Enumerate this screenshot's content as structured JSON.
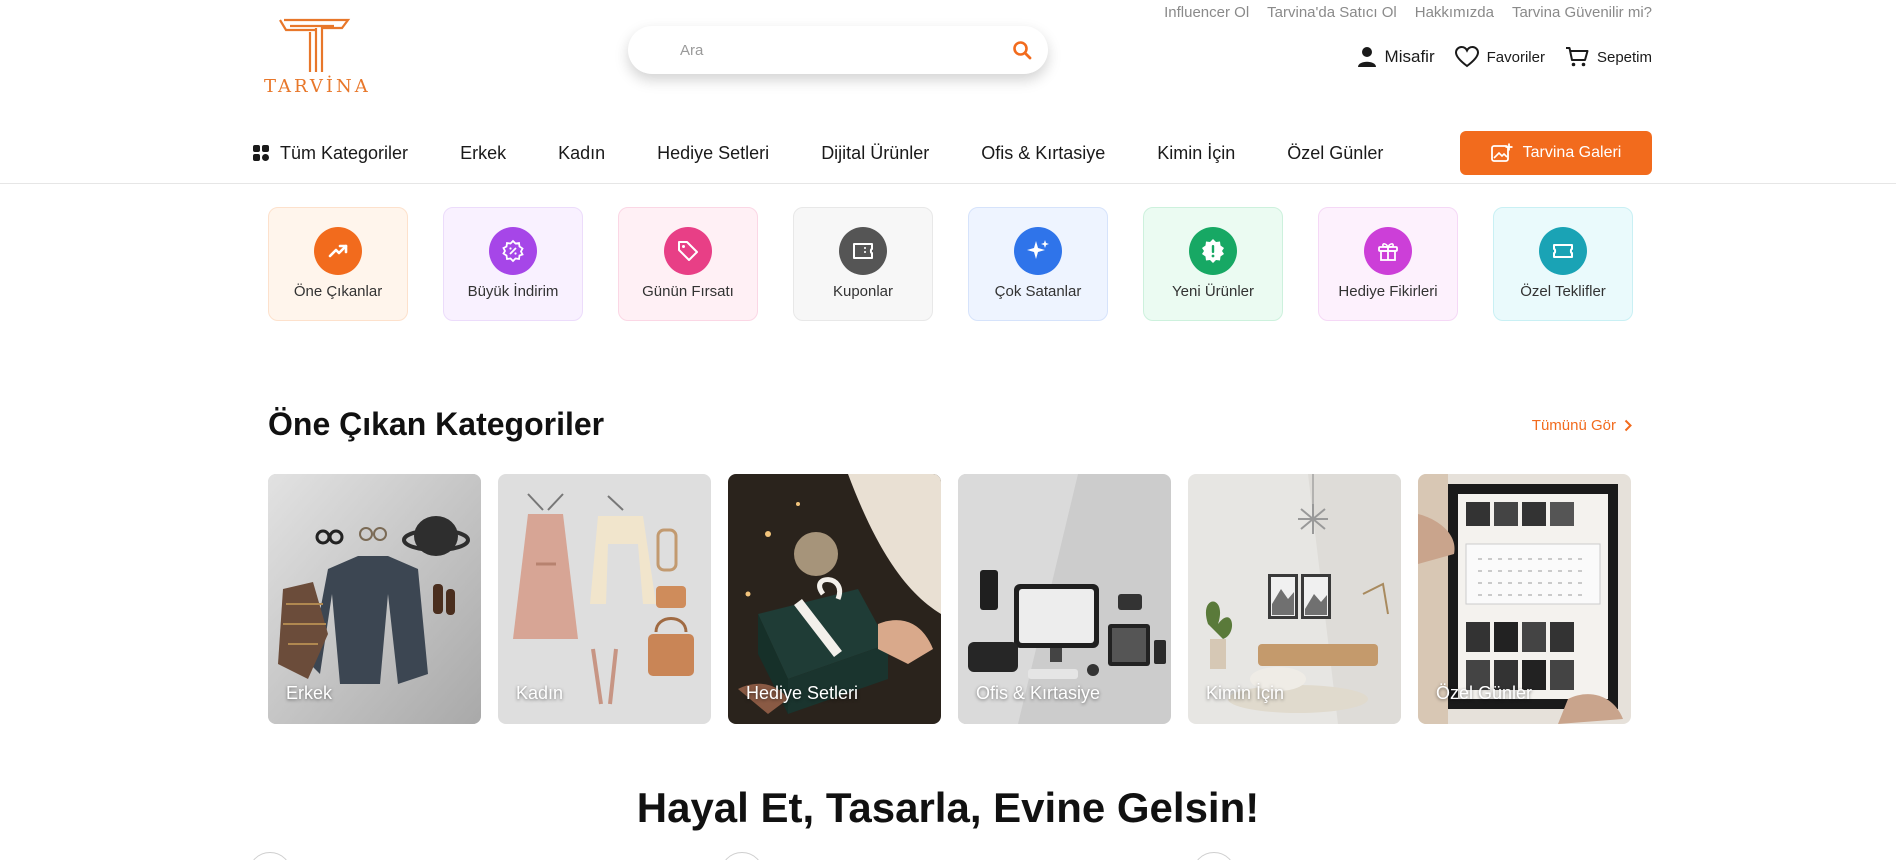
{
  "brand": {
    "name": "TARVİNA",
    "color": "#e8772a"
  },
  "top_links": [
    "Influencer Ol",
    "Tarvina'da Satıcı Ol",
    "Hakkımızda",
    "Tarvina Güvenilir mi?"
  ],
  "search": {
    "placeholder": "Ara",
    "value": ""
  },
  "user_actions": {
    "guest": "Misafir",
    "favorites": "Favoriler",
    "cart": "Sepetim"
  },
  "nav": {
    "all_categories": "Tüm Kategoriler",
    "items": [
      "Erkek",
      "Kadın",
      "Hediye Setleri",
      "Dijital Ürünler",
      "Ofis & Kırtasiye",
      "Kimin İçin",
      "Özel Günler"
    ],
    "gallery_button": "Tarvina Galeri"
  },
  "quick_tiles": [
    {
      "label": "Öne Çıkanlar",
      "icon": "trending-up-icon",
      "color": "#f26b1d",
      "bg": "#fff5ec",
      "border": "#fde1cc"
    },
    {
      "label": "Büyük İndirim",
      "icon": "discount-badge-icon",
      "color": "#a646e8",
      "bg": "#f9f1ff",
      "border": "#ecdcfb"
    },
    {
      "label": "Günün Fırsatı",
      "icon": "tag-icon",
      "color": "#e83f86",
      "bg": "#fff0f5",
      "border": "#fbd7e5"
    },
    {
      "label": "Kuponlar",
      "icon": "coupon-icon",
      "color": "#555555",
      "bg": "#f7f7f7",
      "border": "#e8e8e8"
    },
    {
      "label": "Çok Satanlar",
      "icon": "sparkles-icon",
      "color": "#2f74ea",
      "bg": "#eef4ff",
      "border": "#d6e3fb"
    },
    {
      "label": "Yeni Ürünler",
      "icon": "new-badge-icon",
      "color": "#17a864",
      "bg": "#ebfbf2",
      "border": "#cdf1dd"
    },
    {
      "label": "Hediye Fikirleri",
      "icon": "gift-icon",
      "color": "#cc3fd8",
      "bg": "#fdf1fd",
      "border": "#f5d8f6"
    },
    {
      "label": "Özel Teklifler",
      "icon": "ticket-icon",
      "color": "#1aa3b5",
      "bg": "#eafafc",
      "border": "#c9f0f4"
    }
  ],
  "featured": {
    "title": "Öne Çıkan Kategoriler",
    "see_all": "Tümünü Gör",
    "categories": [
      "Erkek",
      "Kadın",
      "Hediye Setleri",
      "Ofis & Kırtasiye",
      "Kimin İçin",
      "Özel Günler"
    ]
  },
  "hero": {
    "title": "Hayal Et, Tasarla, Evine Gelsin!"
  },
  "colors": {
    "accent": "#f26b1d"
  }
}
